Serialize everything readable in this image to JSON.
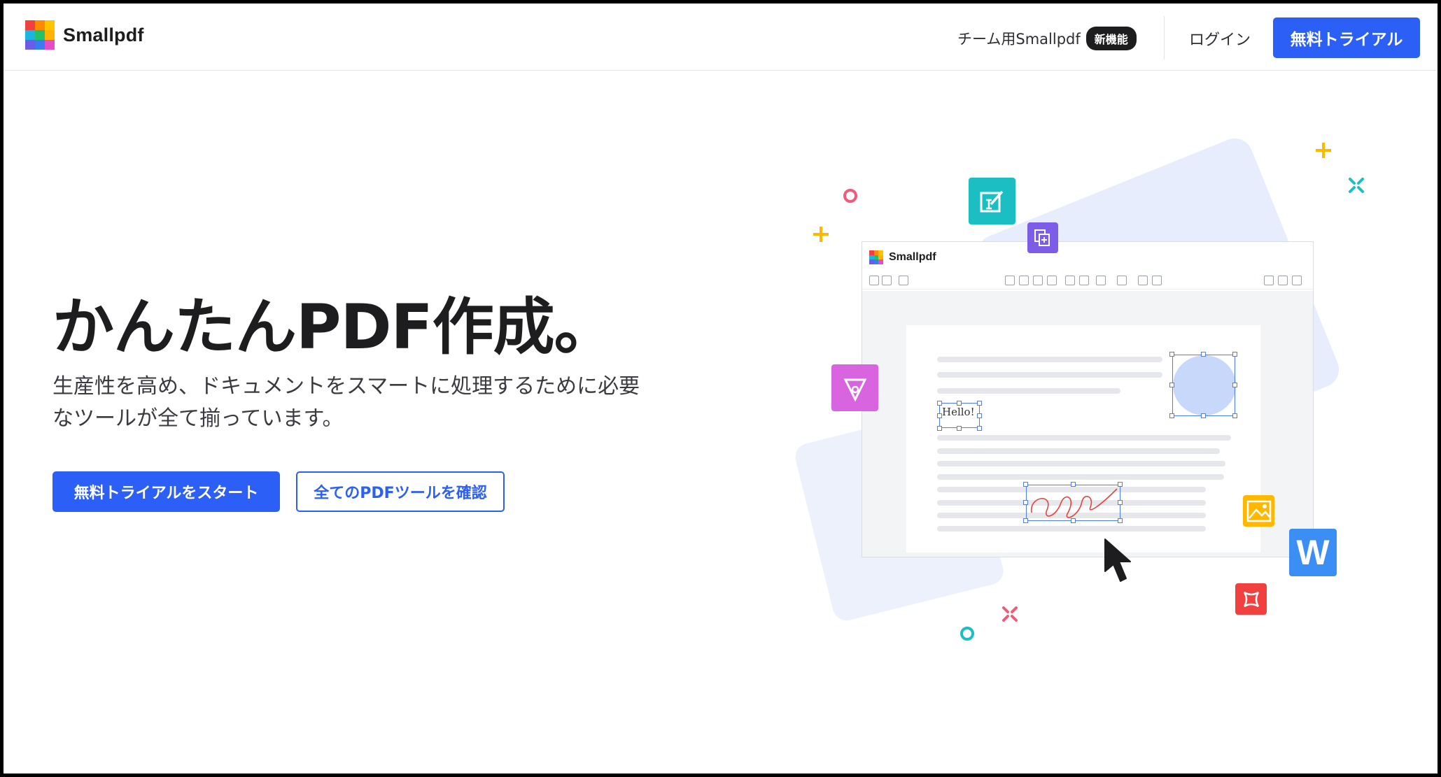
{
  "header": {
    "brand": "Smallpdf",
    "team_link": "チーム用Smallpdf",
    "team_badge": "新機能",
    "login": "ログイン",
    "trial_button": "無料トライアル"
  },
  "hero": {
    "title": "かんたんPDF作成。",
    "subtitle_line1": "生産性を高め、ドキュメントをスマートに処理するために必要",
    "subtitle_line2": "なツールが全て揃っています。",
    "primary_cta": "無料トライアルをスタート",
    "secondary_cta": "全てのPDFツールを確認"
  },
  "illustration": {
    "app_brand": "Smallpdf",
    "hello_text": "Hello!",
    "word_letter": "W",
    "icons": [
      "edit-text-icon",
      "merge-icon",
      "pen-nib-icon",
      "image-icon",
      "word-icon",
      "shape-icon",
      "cursor-icon"
    ]
  },
  "colors": {
    "primary": "#2c5ff6",
    "teal": "#1bbfc3",
    "purple": "#7d5ce8",
    "magenta": "#d964e0",
    "yellow": "#ffb800",
    "word_blue": "#3b8ef3",
    "red": "#f0413f"
  }
}
